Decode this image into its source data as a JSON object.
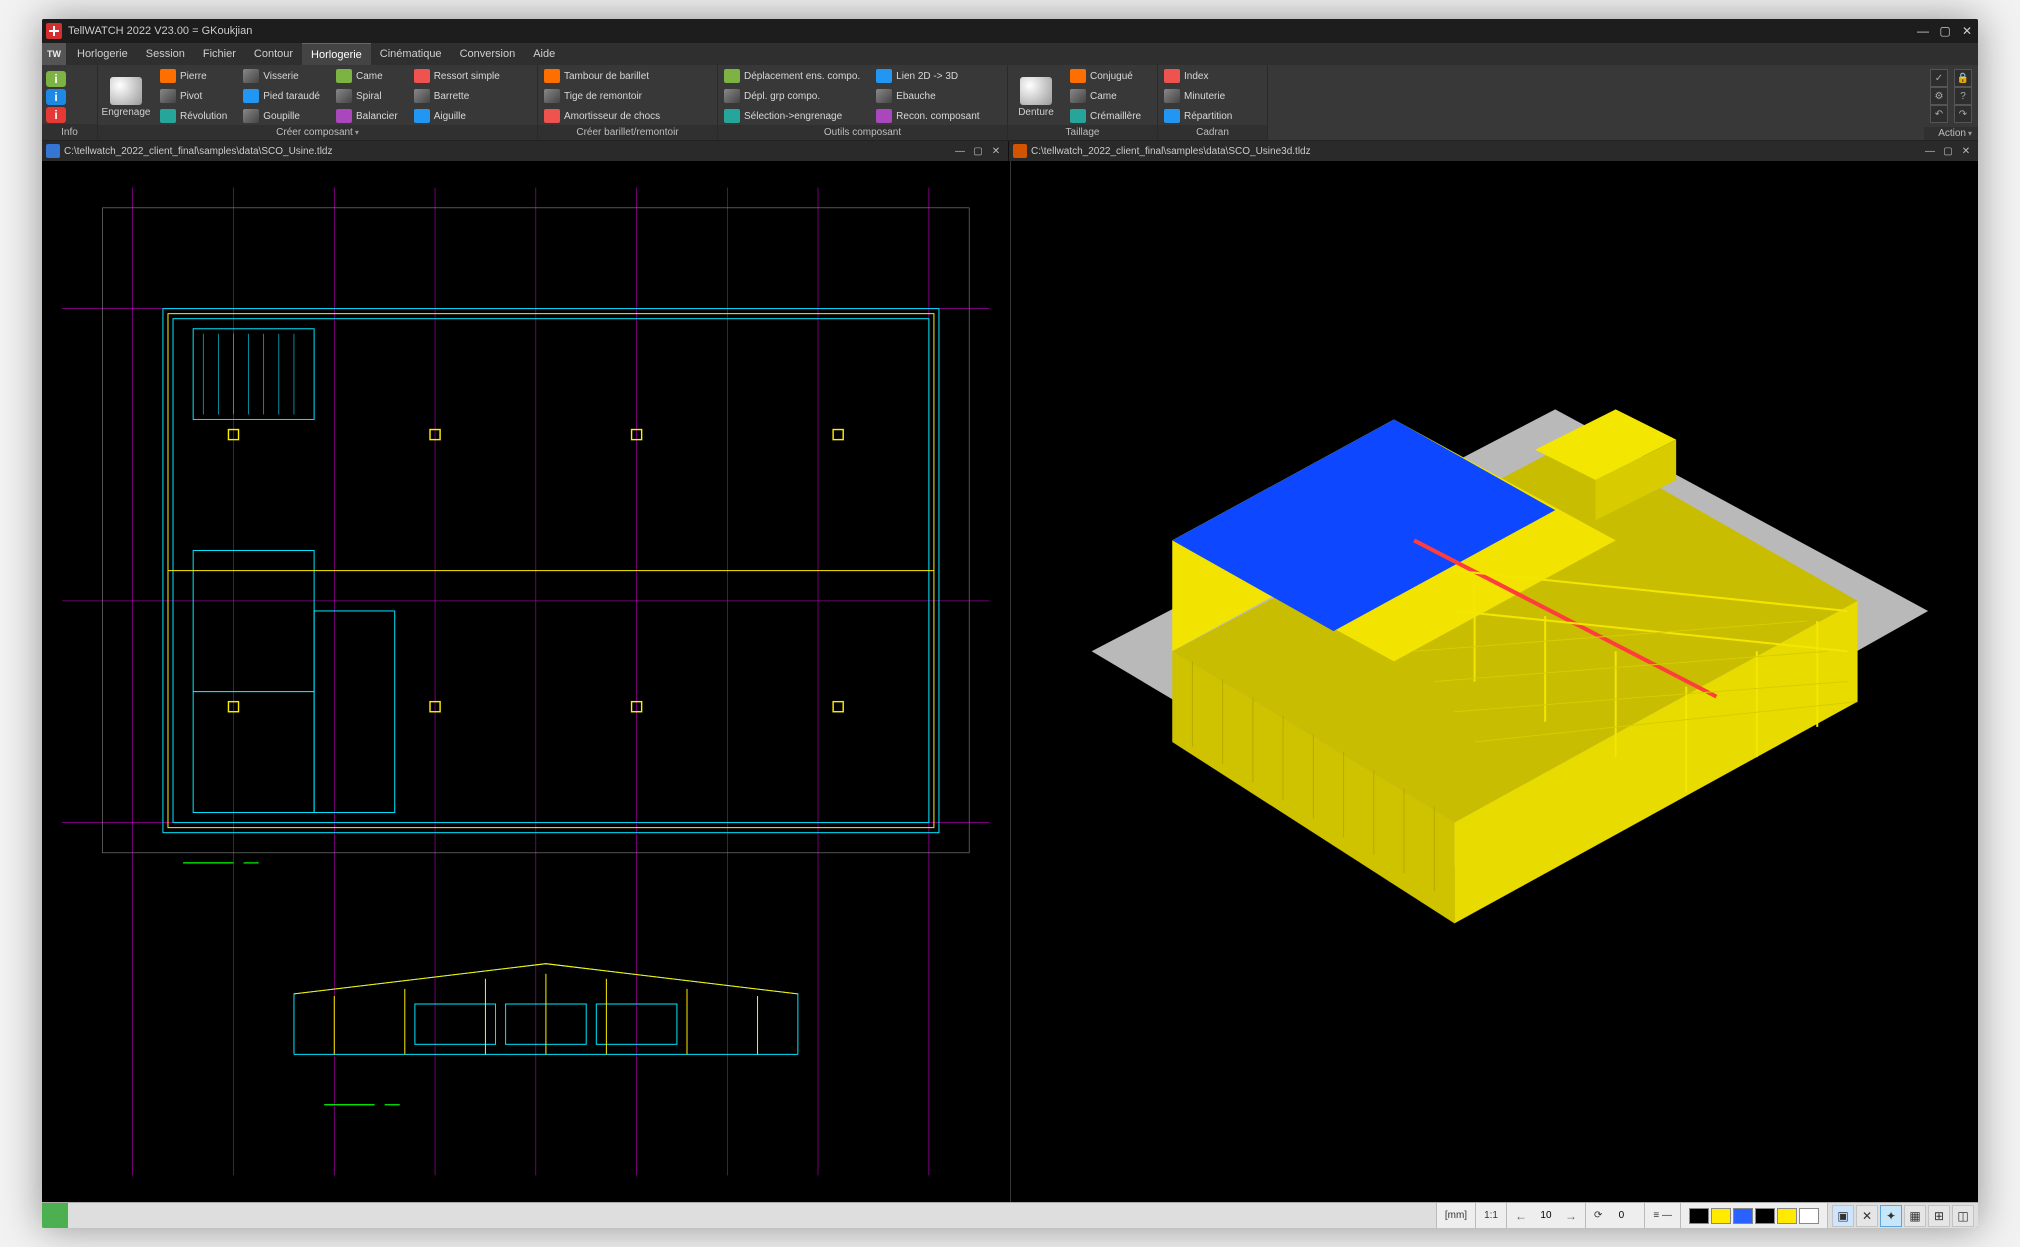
{
  "app": {
    "title": "TellWATCH 2022 V23.00 = GKoukjian",
    "menus": [
      "Horlogerie",
      "Session",
      "Fichier",
      "Contour",
      "Horlogerie",
      "Cinématique",
      "Conversion",
      "Aide"
    ],
    "active_menu_index": 4
  },
  "ribbon": {
    "info_label": "Info",
    "engrenage_btn": "Engrenage",
    "denture_btn": "Denture",
    "create_component": {
      "label": "Créer composant",
      "col1": [
        "Pierre",
        "Pivot",
        "Révolution"
      ],
      "col2": [
        "Visserie",
        "Pied taraudé",
        "Goupille"
      ],
      "col3": [
        "Came",
        "Spiral",
        "Balancier"
      ],
      "col4": [
        "Ressort simple",
        "Barrette",
        "Aiguille"
      ]
    },
    "create_barrel": {
      "label": "Créer barillet/remontoir",
      "items": [
        "Tambour de barillet",
        "Tige de remontoir",
        "Amortisseur de chocs"
      ]
    },
    "outils": {
      "label": "Outils composant",
      "col1": [
        "Déplacement ens. compo.",
        "Dépl. grp compo.",
        "Sélection->engrenage"
      ],
      "col2": [
        "Lien 2D -> 3D",
        "Ebauche",
        "Recon. composant"
      ]
    },
    "taillage": {
      "label": "Taillage",
      "items": [
        "Conjugué",
        "Came",
        "Crémaillère"
      ]
    },
    "cadran": {
      "label": "Cadran",
      "items": [
        "Index",
        "Minuterie",
        "Répartition"
      ]
    },
    "action_label": "Action"
  },
  "documents": {
    "left_path": "C:\\tellwatch_2022_client_final\\samples\\data\\SCO_Usine.tldz",
    "right_path": "C:\\tellwatch_2022_client_final\\samples\\data\\SCO_Usine3d.tldz"
  },
  "status": {
    "unit": "[mm]",
    "scale": "1:1",
    "step": "10",
    "angle": "0"
  },
  "colors": {
    "cad_bg": "#000000",
    "cad_cyan": "#00e5ff",
    "cad_yellow": "#ffee00",
    "cad_magenta": "#ff00ff",
    "cad_green": "#00ff00",
    "ground_3d": "#b9b9b9",
    "roof_blue": "#0d47ff",
    "wall_yellow": "#f3e600",
    "red_beam": "#ff3d3d"
  }
}
